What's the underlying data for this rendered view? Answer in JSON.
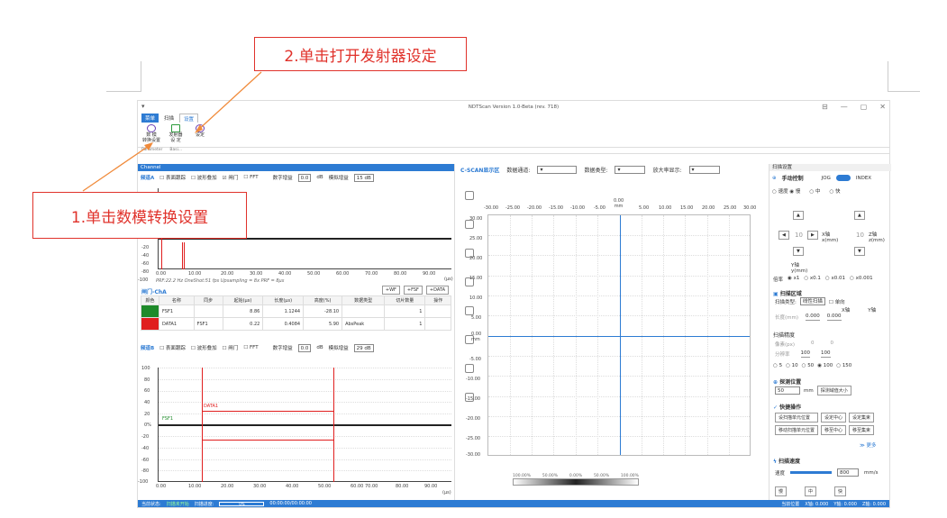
{
  "callouts": {
    "step2": "2.单击打开发射器设定",
    "step1": "1.单击数模转换设置"
  },
  "window": {
    "title": "NDTScan Version 1.0-Beta (rev. 718)",
    "controls": [
      "⊟",
      "—",
      "▢",
      "✕"
    ]
  },
  "ribbon": {
    "tabs": [
      "菜单",
      "扫描",
      "设置"
    ],
    "buttons": [
      "数 模\n转换设置",
      "发射器\n设 定",
      "设定"
    ],
    "groups": [
      "Parameter",
      "Basi..."
    ]
  },
  "channel": {
    "header": "Channel",
    "a_label": "频道A",
    "b_label": "频道B",
    "options": [
      "表面跟踪",
      "波形叠加",
      "闸门",
      "FFT"
    ],
    "digital_gain_label": "数字增益",
    "digital_gain_value": "0.0",
    "db": "dB",
    "analog_gain_label": "模拟增益",
    "analog_gain_a": "15 dB",
    "analog_gain_b": "29 dB",
    "info": "PRF:22.2 Hz  OneShot:51 fps  Upsampling = 8x  PRF = 8μs",
    "gate_title": "闸门-ChA",
    "btn_wf": "+WF",
    "btn_fsf": "+FSF",
    "btn_data": "+DATA",
    "table_headers": [
      "颜色",
      "名称",
      "同步",
      "起始(μs)",
      "长度(μs)",
      "高度(%)",
      "数据类型",
      "切片数量",
      "操作"
    ],
    "table_rows": [
      {
        "color": "#1e8a2a",
        "name": "FSF1",
        "sync": "",
        "start": "8.86",
        "length": "1.1244",
        "height": "-28.10",
        "type": "",
        "slices": "1"
      },
      {
        "color": "#e01e1e",
        "name": "DATA1",
        "sync": "FSF1",
        "start": "0.22",
        "length": "0.4084",
        "height": "5.90",
        "type": "AbsPeak",
        "slices": "1"
      }
    ],
    "x_ticks": [
      "0.00",
      "10.00",
      "20.00",
      "30.00",
      "40.00",
      "50.00",
      "60.00",
      "70.00",
      "80.00",
      "90.00"
    ],
    "x_unit": "(μs)",
    "ya_ticks": [
      "-20",
      "-40",
      "-60",
      "-80",
      "-100"
    ],
    "yb_ticks": [
      "100",
      "80",
      "60",
      "40",
      "20",
      "0%",
      "-20",
      "-40",
      "-60",
      "-80",
      "-100"
    ],
    "gate_labels": {
      "data": "DATA1",
      "fsf": "FSF1"
    }
  },
  "cscan": {
    "title": "C-SCAN显示区",
    "channel_label": "数据通道:",
    "type_label": "数据类型:",
    "zoom_label": "放大率显示:",
    "x_ticks": [
      "-30.00",
      "-25.00",
      "-20.00",
      "-15.00",
      "-10.00",
      "-5.00",
      "0.00\nmm",
      "5.00",
      "10.00",
      "15.00",
      "20.00",
      "25.00",
      "30.00"
    ],
    "y_ticks": [
      "30.00",
      "25.00",
      "20.00",
      "15.00",
      "10.00",
      "5.00",
      "0.00\nmm",
      "-5.00",
      "-10.00",
      "-15.00",
      "-20.00",
      "-25.00",
      "-30.00"
    ],
    "scale": [
      "100.00%",
      "50.00%",
      "0.00%",
      "50.00%",
      "100.00%"
    ]
  },
  "scan_settings": {
    "header": "扫描设置",
    "manual": "手动控制",
    "jog": "JOG",
    "index": "INDEX",
    "speed_opts": [
      "速度",
      "慢",
      "中",
      "快"
    ],
    "axis_values": {
      "x": "10",
      "z": "10"
    },
    "x_label": "X轴\nx(mm)",
    "y_label": "Y轴\ny(mm)",
    "z_label": "Z轴\nz(mm)",
    "rate_label": "倍率",
    "rate_opts": [
      "x1",
      "x0.1",
      "x0.01",
      "x0.001"
    ],
    "area_title": "扫描区域",
    "scan_type_label": "扫描类型:",
    "scan_type_value": "线性扫描",
    "single": "单向",
    "xaxis": "X轴",
    "yaxis": "Y轴",
    "length_label": "长度(mm)",
    "len_x": "0.000",
    "len_y": "0.000",
    "precision_title": "扫描精度",
    "pixel_label": "像素(px)",
    "pixel_values": [
      "0",
      "0"
    ],
    "step_label": "分辨率",
    "step_values": [
      "100",
      "100"
    ],
    "precision_opts": [
      "5",
      "10",
      "50",
      "100",
      "150"
    ],
    "probe_pos_title": "探测位置",
    "probe_value": "50",
    "probe_unit": "mm",
    "probe_btn": "探测域值大小",
    "quick_title": "快捷操作",
    "quick_btns": [
      "设扫描单元位置",
      "设定中心",
      "设定集束",
      "移动扫描单元位置",
      "移至中心",
      "移至集束"
    ],
    "more": "更多",
    "speed_title": "扫描速度",
    "speed_label": "速度",
    "speed_value": "800",
    "speed_unit": "mm/s",
    "speed_btns": [
      "慢",
      "中",
      "快"
    ]
  },
  "status": {
    "state_label": "当前状态:",
    "state": "扫描未开始",
    "progress_label": "扫描进度:",
    "progress": "0%",
    "time": "00:00:00/00:00:00",
    "pos": "当前位置",
    "x": "X轴: 0.000",
    "y": "Y轴: 0.000",
    "z": "Z轴: 0.000"
  },
  "colors": {
    "accent": "#2d7bd3",
    "callout": "#e0322b",
    "wave": "#222222",
    "gate_red": "#e01e1e",
    "gate_green": "#1e8a2a"
  }
}
